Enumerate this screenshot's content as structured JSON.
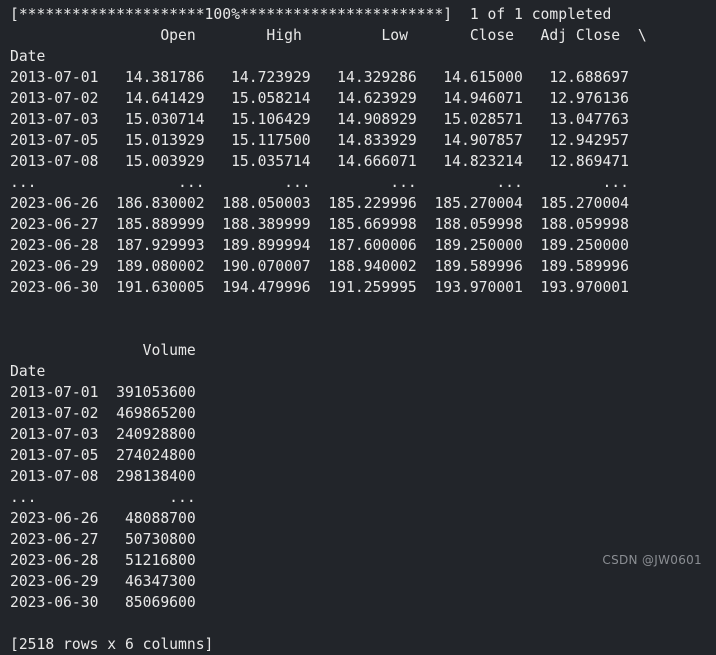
{
  "terminal": {
    "background_color": "#22252a",
    "text_color": "#e8e8e8",
    "watermark": "CSDN @JW0601"
  },
  "progress": {
    "bar_text": "[*********************100%***********************]",
    "status_text": "1 of 1 completed",
    "percent": 100,
    "completed": 1,
    "total": 1,
    "full_line": "[*********************100%***********************]  1 of 1 completed"
  },
  "dataframe": {
    "index_name": "Date",
    "continuation_marker": "\\",
    "ellipsis": "...",
    "summary": "[2518 rows x 6 columns]",
    "rows_count": 2518,
    "columns_count": 6,
    "block1": {
      "headers": [
        "Open",
        "High",
        "Low",
        "Close",
        "Adj Close"
      ],
      "header_line": "                 Open        High         Low       Close   Adj Close  \\",
      "index_label_line": "Date",
      "rows": [
        {
          "date": "2013-07-01",
          "Open": "14.381786",
          "High": "14.723929",
          "Low": "14.329286",
          "Close": "14.615000",
          "Adj Close": "12.688697"
        },
        {
          "date": "2013-07-02",
          "Open": "14.641429",
          "High": "15.058214",
          "Low": "14.623929",
          "Close": "14.946071",
          "Adj Close": "12.976136"
        },
        {
          "date": "2013-07-03",
          "Open": "15.030714",
          "High": "15.106429",
          "Low": "14.908929",
          "Close": "15.028571",
          "Adj Close": "13.047763"
        },
        {
          "date": "2013-07-05",
          "Open": "15.013929",
          "High": "15.117500",
          "Low": "14.833929",
          "Close": "14.907857",
          "Adj Close": "12.942957"
        },
        {
          "date": "2013-07-08",
          "Open": "15.003929",
          "High": "15.035714",
          "Low": "14.666071",
          "Close": "14.823214",
          "Adj Close": "12.869471"
        },
        {
          "date": "...",
          "Open": "...",
          "High": "...",
          "Low": "...",
          "Close": "...",
          "Adj Close": "..."
        },
        {
          "date": "2023-06-26",
          "Open": "186.830002",
          "High": "188.050003",
          "Low": "185.229996",
          "Close": "185.270004",
          "Adj Close": "185.270004"
        },
        {
          "date": "2023-06-27",
          "Open": "185.889999",
          "High": "188.389999",
          "Low": "185.669998",
          "Close": "188.059998",
          "Adj Close": "188.059998"
        },
        {
          "date": "2023-06-28",
          "Open": "187.929993",
          "High": "189.899994",
          "Low": "187.600006",
          "Close": "189.250000",
          "Adj Close": "189.250000"
        },
        {
          "date": "2023-06-29",
          "Open": "189.080002",
          "High": "190.070007",
          "Low": "188.940002",
          "Close": "189.589996",
          "Adj Close": "189.589996"
        },
        {
          "date": "2023-06-30",
          "Open": "191.630005",
          "High": "194.479996",
          "Low": "191.259995",
          "Close": "193.970001",
          "Adj Close": "193.970001"
        }
      ],
      "lines": [
        "                 Open        High         Low       Close   Adj Close  \\",
        "Date",
        "2013-07-01   14.381786   14.723929   14.329286   14.615000   12.688697",
        "2013-07-02   14.641429   15.058214   14.623929   14.946071   12.976136",
        "2013-07-03   15.030714   15.106429   14.908929   15.028571   13.047763",
        "2013-07-05   15.013929   15.117500   14.833929   14.907857   12.942957",
        "2013-07-08   15.003929   15.035714   14.666071   14.823214   12.869471",
        "...                ...         ...         ...         ...         ...",
        "2023-06-26  186.830002  188.050003  185.229996  185.270004  185.270004",
        "2023-06-27  185.889999  188.389999  185.669998  188.059998  188.059998",
        "2023-06-28  187.929993  189.899994  187.600006  189.250000  189.250000",
        "2023-06-29  189.080002  190.070007  188.940002  189.589996  189.589996",
        "2023-06-30  191.630005  194.479996  191.259995  193.970001  193.970001"
      ]
    },
    "block2": {
      "headers": [
        "Volume"
      ],
      "header_line": "               Volume",
      "index_label_line": "Date",
      "rows": [
        {
          "date": "2013-07-01",
          "Volume": "391053600"
        },
        {
          "date": "2013-07-02",
          "Volume": "469865200"
        },
        {
          "date": "2013-07-03",
          "Volume": "240928800"
        },
        {
          "date": "2013-07-05",
          "Volume": "274024800"
        },
        {
          "date": "2013-07-08",
          "Volume": "298138400"
        },
        {
          "date": "...",
          "Volume": "..."
        },
        {
          "date": "2023-06-26",
          "Volume": "48088700"
        },
        {
          "date": "2023-06-27",
          "Volume": "50730800"
        },
        {
          "date": "2023-06-28",
          "Volume": "51216800"
        },
        {
          "date": "2023-06-29",
          "Volume": "46347300"
        },
        {
          "date": "2023-06-30",
          "Volume": "85069600"
        }
      ],
      "lines": [
        "               Volume",
        "Date",
        "2013-07-01  391053600",
        "2013-07-02  469865200",
        "2013-07-03  240928800",
        "2013-07-05  274024800",
        "2013-07-08  298138400",
        "...               ...",
        "2023-06-26   48088700",
        "2023-06-27   50730800",
        "2023-06-28   51216800",
        "2023-06-29   46347300",
        "2023-06-30   85069600"
      ]
    }
  },
  "output_lines": [
    "[*********************100%***********************]  1 of 1 completed",
    "                 Open        High         Low       Close   Adj Close  \\",
    "Date",
    "2013-07-01   14.381786   14.723929   14.329286   14.615000   12.688697",
    "2013-07-02   14.641429   15.058214   14.623929   14.946071   12.976136",
    "2013-07-03   15.030714   15.106429   14.908929   15.028571   13.047763",
    "2013-07-05   15.013929   15.117500   14.833929   14.907857   12.942957",
    "2013-07-08   15.003929   15.035714   14.666071   14.823214   12.869471",
    "...                ...         ...         ...         ...         ...",
    "2023-06-26  186.830002  188.050003  185.229996  185.270004  185.270004",
    "2023-06-27  185.889999  188.389999  185.669998  188.059998  188.059998",
    "2023-06-28  187.929993  189.899994  187.600006  189.250000  189.250000",
    "2023-06-29  189.080002  190.070007  188.940002  189.589996  189.589996",
    "2023-06-30  191.630005  194.479996  191.259995  193.970001  193.970001",
    "",
    "               Volume",
    "Date",
    "2013-07-01  391053600",
    "2013-07-02  469865200",
    "2013-07-03  240928800",
    "2013-07-05  274024800",
    "2013-07-08  298138400",
    "...               ...",
    "2023-06-26   48088700",
    "2023-06-27   50730800",
    "2023-06-28   51216800",
    "2023-06-29   46347300",
    "2023-06-30   85069600",
    "",
    "[2518 rows x 6 columns]"
  ]
}
